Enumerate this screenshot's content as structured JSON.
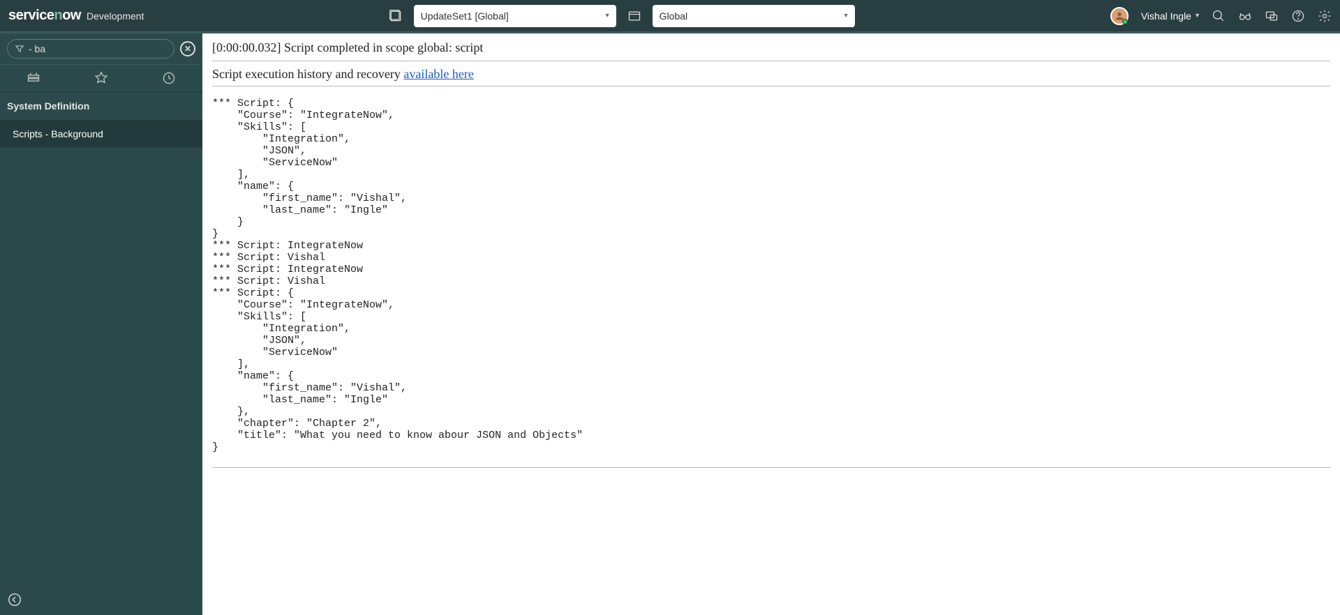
{
  "header": {
    "logo_service": "service",
    "logo_n": "n",
    "logo_ow": "ow",
    "env": "Development",
    "updateset_value": "UpdateSet1 [Global]",
    "scope_value": "Global",
    "username": "Vishal Ingle"
  },
  "sidebar": {
    "filter_value": "- ba",
    "category": "System Definition",
    "items": [
      {
        "label": "Scripts - Background"
      }
    ]
  },
  "content": {
    "status_line": "[0:00:00.032] Script completed in scope global: script",
    "history_prefix": "Script execution history and recovery ",
    "history_link": "available here",
    "script_output": "*** Script: {\n    \"Course\": \"IntegrateNow\",\n    \"Skills\": [\n        \"Integration\",\n        \"JSON\",\n        \"ServiceNow\"\n    ],\n    \"name\": {\n        \"first_name\": \"Vishal\",\n        \"last_name\": \"Ingle\"\n    }\n}\n*** Script: IntegrateNow\n*** Script: Vishal\n*** Script: IntegrateNow\n*** Script: Vishal\n*** Script: {\n    \"Course\": \"IntegrateNow\",\n    \"Skills\": [\n        \"Integration\",\n        \"JSON\",\n        \"ServiceNow\"\n    ],\n    \"name\": {\n        \"first_name\": \"Vishal\",\n        \"last_name\": \"Ingle\"\n    },\n    \"chapter\": \"Chapter 2\",\n    \"title\": \"What you need to know abour JSON and Objects\"\n}"
  }
}
